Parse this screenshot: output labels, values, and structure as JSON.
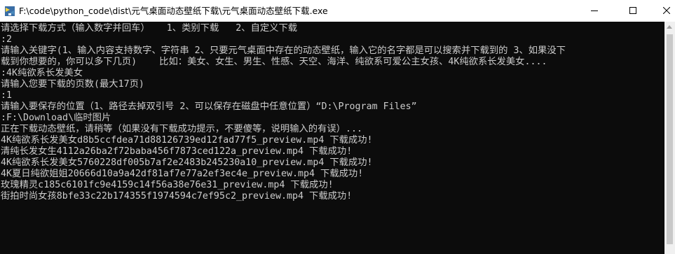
{
  "window": {
    "title": "F:\\code\\python_code\\dist\\元气桌面动态壁纸下载\\元气桌面动态壁纸下载.exe",
    "icon": "console-app-icon"
  },
  "console": {
    "lines": [
      "请选择下载方式（输入数字并回车）   1、类别下载   2、自定义下载",
      ":2",
      "请输入关键字(1、输入内容支持数字、字符串 2、只要元气桌面中存在的动态壁纸，输入它的名字都是可以搜索并下载到的 3、如果没下",
      "载到你想要的，你可以多下几页)    比如：美女、女生、男生、性感、天空、海洋、纯欲系可爱公主女孩、4K纯欲系长发美女....",
      ":4K纯欲系长发美女",
      "请输入您要下载的页数(最大17页)",
      ":1",
      "请输入要保存的位置（1、路径去掉双引号 2、可以保存在磁盘中任意位置）“D:\\Program Files”",
      ":F:\\Download\\临时图片",
      "正在下载动态壁纸，请稍等（如果没有下载成功提示，不要傻等，说明输入的有误）...",
      "4K纯欲系长发美女d8b5ccfdea71d88126739ed12fad77f5_preview.mp4 下载成功!",
      "清纯长发女生4112a26ba2f72baba456f7873ced122a_preview.mp4 下载成功!",
      "4K纯欲系长发美女5760228df005b7af2e2483b245230a10_preview.mp4 下载成功!",
      "4K夏日纯欲姐姐20666d10a9a42df81af7e77a2ef3ec4e_preview.mp4 下载成功!",
      "玫瑰精灵c185c6101fc9e4159c14f56a38e76e31_preview.mp4 下载成功!",
      "街拍时尚女孩8bfe33c22b174355f1974594c7ef95c2_preview.mp4 下载成功!"
    ]
  },
  "colors": {
    "titlebar_bg": "#ffffff",
    "console_bg": "#0c0c0c",
    "console_text": "#cccccc"
  }
}
